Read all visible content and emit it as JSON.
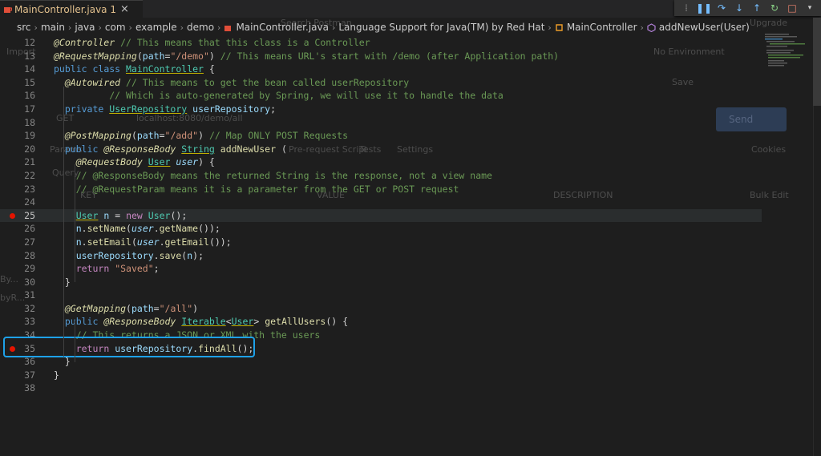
{
  "tab": {
    "label": "MainController.java 1",
    "close": "×"
  },
  "ghost": {
    "search": "Search Postman",
    "upgrade": "Upgrade",
    "import": "Import",
    "env": "No Environment",
    "save": "Save",
    "get": "GET",
    "url": "localhost:8080/demo/all",
    "send": "Send",
    "params": "Params",
    "prereq": "Pre-request Script",
    "tests": "Tests",
    "settings": "Settings",
    "cookies": "Cookies",
    "query": "Query",
    "key": "KEY",
    "value": "VALUE",
    "description": "DESCRIPTION",
    "bulk": "Bulk Edit",
    "by1": "By...",
    "by2": "byR..."
  },
  "breadcrumb": [
    "src",
    "main",
    "java",
    "com",
    "example",
    "demo",
    "MainController.java",
    "Language Support for Java(TM) by Red Hat",
    "MainController",
    "addNewUser(User)"
  ],
  "lines": [
    {
      "n": "12",
      "tokens": [
        [
          "ann-i",
          "@Controller"
        ],
        [
          "cm",
          " // This means that this class is a Controller"
        ]
      ]
    },
    {
      "n": "13",
      "tokens": [
        [
          "ann-i",
          "@RequestMapping"
        ],
        [
          "",
          "("
        ],
        [
          "pa",
          "path"
        ],
        [
          "",
          "="
        ],
        [
          "str",
          "\"/demo\""
        ],
        [
          "",
          ")"
        ],
        [
          "cm",
          " // This means URL's start with /demo (after Application path)"
        ]
      ]
    },
    {
      "n": "14",
      "tokens": [
        [
          "kw",
          "public"
        ],
        [
          "",
          " "
        ],
        [
          "kw",
          "class"
        ],
        [
          "",
          " "
        ],
        [
          "ty uy",
          "MainController"
        ],
        [
          "",
          " {"
        ]
      ]
    },
    {
      "n": "15",
      "tokens": [
        [
          "",
          ""
        ],
        [
          "ann-i",
          "  @Autowired"
        ],
        [
          "cm",
          " // This means to get the bean called userRepository"
        ]
      ]
    },
    {
      "n": "16",
      "tokens": [
        [
          "cm",
          "          // Which is auto-generated by Spring, we will use it to handle the data"
        ]
      ]
    },
    {
      "n": "17",
      "tokens": [
        [
          "",
          "  "
        ],
        [
          "kw",
          "private"
        ],
        [
          "",
          " "
        ],
        [
          "ty uy",
          "UserRepository"
        ],
        [
          "",
          " "
        ],
        [
          "pa",
          "userRepository"
        ],
        [
          "",
          ";"
        ]
      ]
    },
    {
      "n": "18",
      "tokens": []
    },
    {
      "n": "19",
      "tokens": [
        [
          "",
          "  "
        ],
        [
          "ann-i",
          "@PostMapping"
        ],
        [
          "",
          "("
        ],
        [
          "pa",
          "path"
        ],
        [
          "",
          "="
        ],
        [
          "str",
          "\"/add\""
        ],
        [
          "",
          ")"
        ],
        [
          "cm",
          " // Map ONLY POST Requests"
        ]
      ]
    },
    {
      "n": "20",
      "tokens": [
        [
          "",
          "  "
        ],
        [
          "kw",
          "public"
        ],
        [
          "",
          " "
        ],
        [
          "ann-i",
          "@ResponseBody"
        ],
        [
          "",
          " "
        ],
        [
          "ty uy",
          "String"
        ],
        [
          "",
          " "
        ],
        [
          "fn",
          "addNewUser"
        ],
        [
          "",
          " ("
        ]
      ]
    },
    {
      "n": "21",
      "tokens": [
        [
          "",
          "    "
        ],
        [
          "ann-i",
          "@RequestBody"
        ],
        [
          "",
          " "
        ],
        [
          "ty uy",
          "User"
        ],
        [
          "",
          " "
        ],
        [
          "pa-i",
          "user"
        ],
        [
          "",
          ") {"
        ]
      ]
    },
    {
      "n": "22",
      "tokens": [
        [
          "",
          "    "
        ],
        [
          "cm",
          "// @ResponseBody means the returned String is the response, not a view name"
        ]
      ]
    },
    {
      "n": "23",
      "tokens": [
        [
          "",
          "    "
        ],
        [
          "cm",
          "// @RequestParam means it is a parameter from the GET or POST request"
        ]
      ]
    },
    {
      "n": "24",
      "tokens": []
    },
    {
      "n": "25",
      "bp": true,
      "hl": true,
      "tokens": [
        [
          "",
          "    "
        ],
        [
          "ty uy",
          "User"
        ],
        [
          "",
          " "
        ],
        [
          "pa",
          "n"
        ],
        [
          "",
          " = "
        ],
        [
          "kw2",
          "new"
        ],
        [
          "",
          " "
        ],
        [
          "ty",
          "User"
        ],
        [
          "",
          "();"
        ]
      ]
    },
    {
      "n": "26",
      "tokens": [
        [
          "",
          "    "
        ],
        [
          "pa",
          "n"
        ],
        [
          "",
          "."
        ],
        [
          "fn",
          "setName"
        ],
        [
          "",
          "("
        ],
        [
          "pa-i",
          "user"
        ],
        [
          "",
          "."
        ],
        [
          "fn",
          "getName"
        ],
        [
          "",
          "());"
        ]
      ]
    },
    {
      "n": "27",
      "tokens": [
        [
          "",
          "    "
        ],
        [
          "pa",
          "n"
        ],
        [
          "",
          "."
        ],
        [
          "fn",
          "setEmail"
        ],
        [
          "",
          "("
        ],
        [
          "pa-i",
          "user"
        ],
        [
          "",
          "."
        ],
        [
          "fn",
          "getEmail"
        ],
        [
          "",
          "());"
        ]
      ]
    },
    {
      "n": "28",
      "tokens": [
        [
          "",
          "    "
        ],
        [
          "pa",
          "userRepository"
        ],
        [
          "",
          "."
        ],
        [
          "fn",
          "save"
        ],
        [
          "",
          "("
        ],
        [
          "pa",
          "n"
        ],
        [
          "",
          ");"
        ]
      ]
    },
    {
      "n": "29",
      "tokens": [
        [
          "",
          "    "
        ],
        [
          "kw2",
          "return"
        ],
        [
          "",
          " "
        ],
        [
          "str",
          "\"Saved\""
        ],
        [
          "",
          ";"
        ]
      ]
    },
    {
      "n": "30",
      "tokens": [
        [
          "",
          "  }"
        ]
      ]
    },
    {
      "n": "31",
      "tokens": []
    },
    {
      "n": "32",
      "tokens": [
        [
          "",
          "  "
        ],
        [
          "ann-i",
          "@GetMapping"
        ],
        [
          "",
          "("
        ],
        [
          "pa",
          "path"
        ],
        [
          "",
          "="
        ],
        [
          "str",
          "\"/all\""
        ],
        [
          "",
          ")"
        ]
      ]
    },
    {
      "n": "33",
      "tokens": [
        [
          "",
          "  "
        ],
        [
          "kw",
          "public"
        ],
        [
          "",
          " "
        ],
        [
          "ann-i",
          "@ResponseBody"
        ],
        [
          "",
          " "
        ],
        [
          "ty uy",
          "Iterable"
        ],
        [
          "",
          "<"
        ],
        [
          "ty uy",
          "User"
        ],
        [
          "",
          "> "
        ],
        [
          "fn",
          "getAllUsers"
        ],
        [
          "",
          "() {"
        ]
      ]
    },
    {
      "n": "34",
      "tokens": [
        [
          "",
          "    "
        ],
        [
          "cm",
          "// This returns a JSON or XML with the users"
        ]
      ]
    },
    {
      "n": "35",
      "bp": true,
      "tokens": [
        [
          "",
          "    "
        ],
        [
          "kw2",
          "return"
        ],
        [
          "",
          " "
        ],
        [
          "pa",
          "userRepository"
        ],
        [
          "",
          "."
        ],
        [
          "fn",
          "findAll"
        ],
        [
          "",
          "();"
        ]
      ]
    },
    {
      "n": "36",
      "tokens": [
        [
          "",
          "  }"
        ]
      ]
    },
    {
      "n": "37",
      "tokens": [
        [
          "",
          "}"
        ]
      ]
    },
    {
      "n": "38",
      "tokens": []
    }
  ],
  "current_line": "25",
  "colors": {
    "breakpoint": "#e51400",
    "highlight_box": "#1ea1e8"
  }
}
